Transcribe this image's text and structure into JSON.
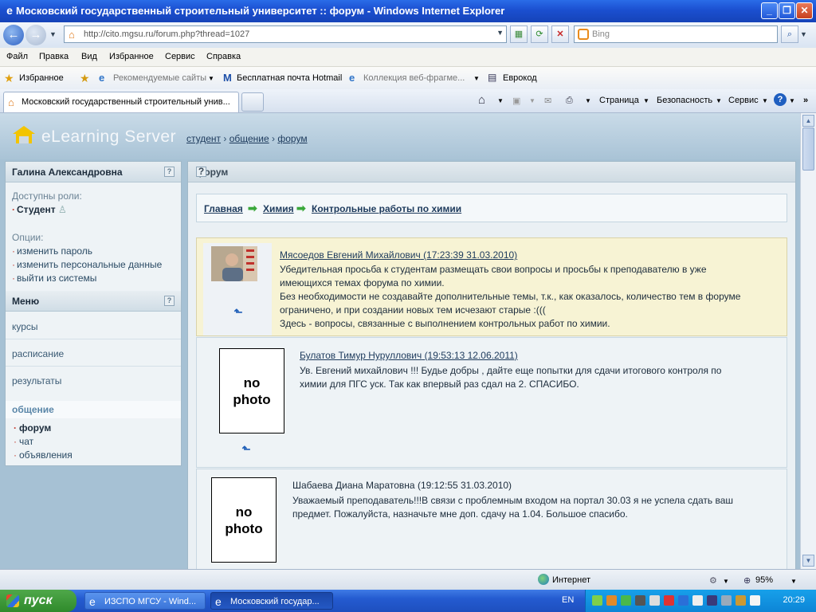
{
  "window": {
    "title": "Московский государственный строительный университет :: форум - Windows Internet Explorer",
    "ie_icon": "ie-logo-icon"
  },
  "address_bar": {
    "url": "http://cito.mgsu.ru/forum.php?thread=1027",
    "search_placeholder": "Bing"
  },
  "menu": [
    "Файл",
    "Правка",
    "Вид",
    "Избранное",
    "Сервис",
    "Справка"
  ],
  "favorites_bar": {
    "favorites_label": "Избранное",
    "items": [
      "Рекомендуемые сайты",
      "Бесплатная почта Hotmail",
      "Коллекция веб-фрагме...",
      "Еврокод"
    ]
  },
  "tabs": {
    "active_tab": "Московский государственный строительный унив...",
    "commands": [
      "Страница",
      "Безопасность",
      "Сервис"
    ]
  },
  "site": {
    "logo_text": "eLearning Server",
    "breadcrumbs": [
      "студент",
      "общение",
      "форум"
    ],
    "separator": "›"
  },
  "left_panel": {
    "user_name": "Галина  Александровна",
    "roles_label": "Доступны роли:",
    "role": "Студент",
    "options_label": "Опции:",
    "options": [
      "изменить пароль",
      "изменить персональные данные",
      "выйти из системы"
    ],
    "menu_title": "Меню",
    "menu_items": [
      "курсы",
      "расписание",
      "результаты"
    ],
    "active_menu": "общение",
    "sub_items": [
      "форум",
      "чат",
      "объявления"
    ],
    "help_icon": "?"
  },
  "main": {
    "header": "форум",
    "forum_crumbs": [
      "Главная",
      "Химия",
      "Контрольные работы по химии"
    ],
    "no_photo_line1": "no",
    "no_photo_line2": "photo",
    "posts": [
      {
        "author": "Мясоедов Евгений Михайлович",
        "time": "(17:23:39 31.03.2010)",
        "lines": [
          "Убедительная просьба к студентам размещать свои вопросы и просьбы к преподавателю в уже",
          "имеющихся темах форума по химии.",
          "Без необходимости не создавайте дополнительные темы, т.к., как оказалось, количество тем в форуме",
          "ограничено, и при создании новых тем исчезают старые :(((",
          "Здесь - вопросы, связанные с выполнением контрольных работ по химии."
        ]
      },
      {
        "author": "Булатов Тимур Нуруллович",
        "time": "(19:53:13 12.06.2011)",
        "lines": [
          "Ув. Евгений михайлович !!! Будье добры , дайте еще попытки для сдачи итогового контроля по",
          "химии для ПГС уск. Так как впервый раз сдал на 2. СПАСИБО."
        ]
      },
      {
        "author": "Шабаева Диана Маратовна",
        "time": "(19:12:55 31.03.2010)",
        "lines": [
          "Уважаемый преподаватель!!!В связи с проблемным входом на портал 30.03 я не успела сдать ваш",
          "предмет. Пожалуйста, назначьте мне доп. сдачу на 1.04. Большое спасибо."
        ]
      }
    ]
  },
  "status_bar": {
    "zone": "Интернет",
    "zoom": "95%"
  },
  "taskbar": {
    "start": "пуск",
    "tasks": [
      "ИЗСПО МГСУ - Wind...",
      "Московский государ..."
    ],
    "lang": "EN",
    "clock": "20:29"
  }
}
